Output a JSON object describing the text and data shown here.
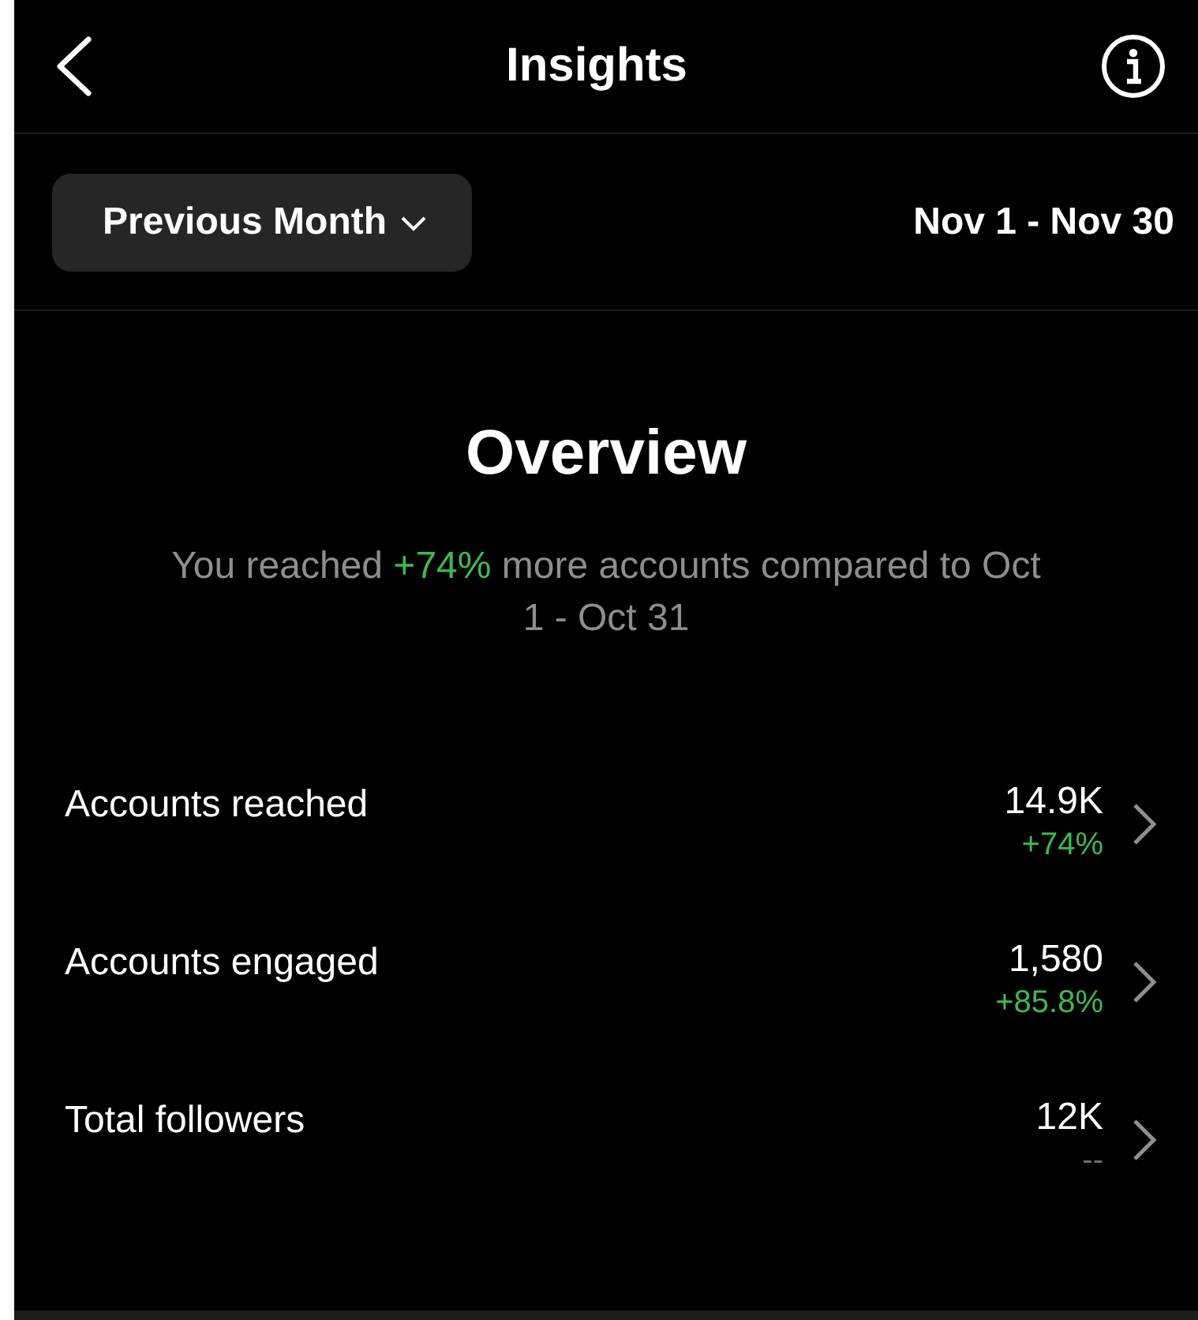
{
  "header": {
    "title": "Insights"
  },
  "filter": {
    "period": "Previous Month",
    "date_range": "Nov 1 - Nov 30"
  },
  "overview": {
    "title": "Overview",
    "summary": {
      "before": "You reached ",
      "highlight": "+74%",
      "after": " more accounts compared to Oct 1 - Oct 31"
    }
  },
  "metrics": [
    {
      "label": "Accounts reached",
      "value": "14.9K",
      "change": "+74%",
      "color": "#3fb950"
    },
    {
      "label": "Accounts engaged",
      "value": "1,580",
      "change": "+85.8%",
      "color": "#3fb950"
    },
    {
      "label": "Total followers",
      "value": "12K",
      "change": "--",
      "color": "#6e6e6e"
    }
  ]
}
